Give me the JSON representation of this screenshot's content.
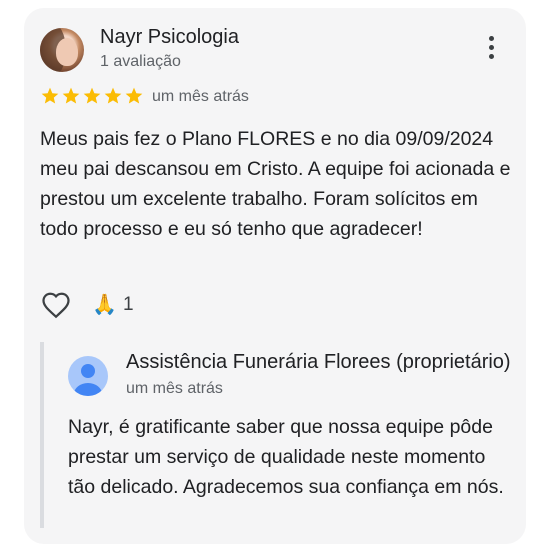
{
  "review": {
    "reviewer_name": "Nayr Psicologia",
    "review_count": "1 avaliação",
    "rating": 5,
    "rating_max": 5,
    "star_color": "#fbbc04",
    "date": "um mês atrás",
    "text": "Meus pais fez o Plano FLORES e no dia 09/09/2024 meu pai descansou em Cristo. A equipe foi acionada e prestou um excelente trabalho. Foram solícitos em todo processo e eu só tenho que agradecer!",
    "more_icon": "more-vert-icon"
  },
  "reactions": {
    "like_icon": "heart-outline-icon",
    "emoji": "🙏",
    "count": "1"
  },
  "owner_reply": {
    "name": "Assistência Funerária Florees (proprietário)",
    "date": "um mês atrás",
    "avatar_icon": "default-person-avatar-icon",
    "avatar_color": "#5e97f6",
    "text": "Nayr, é gratificante saber que nossa equipe pôde prestar um serviço de qualidade neste momento tão delicado. Agradecemos sua confiança em nós."
  }
}
